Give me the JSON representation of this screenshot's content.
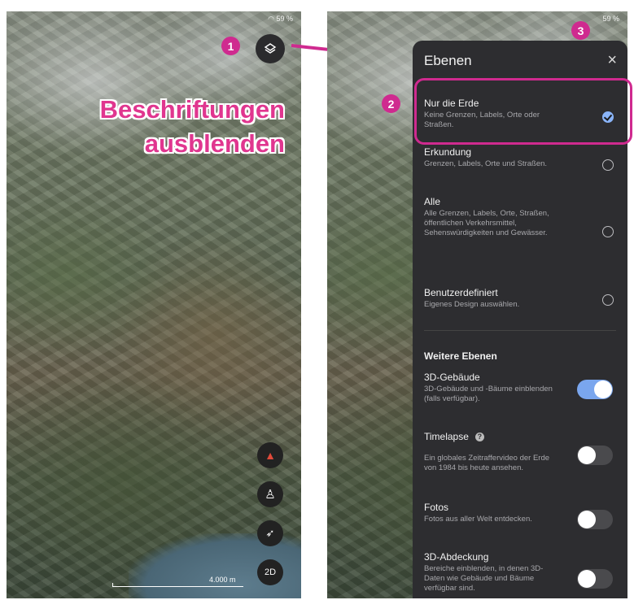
{
  "left_screen": {
    "status": "59 %",
    "headline_line1": "Beschriftungen",
    "headline_line2": "ausblenden",
    "scale_label": "4.000 m",
    "ctl_2d": "2D"
  },
  "callouts": [
    "1",
    "2",
    "3"
  ],
  "right_screen": {
    "status": "59 %",
    "panel": {
      "title": "Ebenen",
      "close": "×",
      "options": [
        {
          "title": "Nur die Erde",
          "desc": "Keine Grenzen, Labels, Orte oder Straßen.",
          "selected": true
        },
        {
          "title": "Erkundung",
          "desc": "Grenzen, Labels, Orte und Straßen.",
          "selected": false
        },
        {
          "title": "Alle",
          "desc": "Alle Grenzen, Labels, Orte, Straßen, öffentlichen Verkehrsmittel, Sehenswürdigkeiten und Gewässer.",
          "selected": false
        },
        {
          "title": "Benutzerdefiniert",
          "desc": "Eigenes Design auswählen.",
          "selected": false
        }
      ],
      "section_title": "Weitere Ebenen",
      "toggles": [
        {
          "title": "3D-Gebäude",
          "desc": "3D-Gebäude und -Bäume einblenden (falls verfügbar).",
          "on": true
        },
        {
          "title": "Timelapse",
          "desc": "Ein globales Zeitraffervideo der Erde von 1984 bis heute ansehen.",
          "on": false
        },
        {
          "title": "Fotos",
          "desc": "Fotos aus aller Welt entdecken.",
          "on": false
        },
        {
          "title": "3D-Abdeckung",
          "desc": "Bereiche einblenden, in denen 3D-Daten wie Gebäude und Bäume verfügbar sind.",
          "on": false
        }
      ]
    }
  },
  "colors": {
    "callout": "#cf2a8f",
    "headline": "#e0368f",
    "panel_bg": "#2d2d30",
    "accent": "#8ab4f8"
  }
}
